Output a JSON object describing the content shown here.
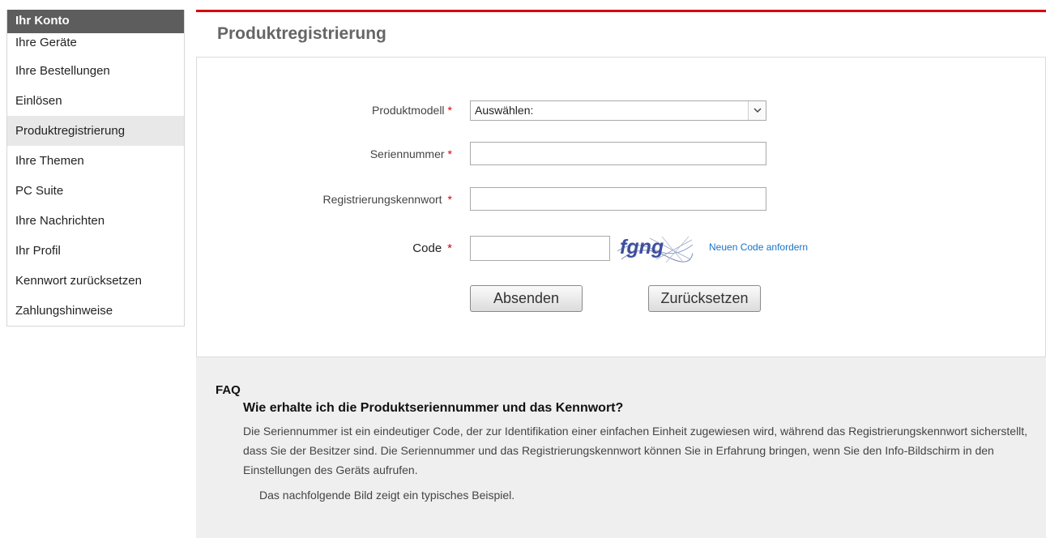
{
  "sidebar": {
    "title": "Ihr Konto",
    "items": [
      {
        "label": "Ihre Geräte"
      },
      {
        "label": "Ihre Bestellungen"
      },
      {
        "label": "Einlösen"
      },
      {
        "label": "Produktregistrierung"
      },
      {
        "label": "Ihre Themen"
      },
      {
        "label": "PC Suite"
      },
      {
        "label": "Ihre Nachrichten"
      },
      {
        "label": "Ihr Profil"
      },
      {
        "label": "Kennwort zurücksetzen"
      },
      {
        "label": "Zahlungshinweise"
      }
    ],
    "active_index": 3
  },
  "page": {
    "title": "Produktregistrierung",
    "accent_color": "#d7000f"
  },
  "form": {
    "required_marker": "*",
    "model": {
      "label": "Produktmodell",
      "selected": "Auswählen:"
    },
    "serial": {
      "label": "Seriennummer",
      "value": "",
      "placeholder": ""
    },
    "password": {
      "label": "Registrierungskennwort",
      "value": "",
      "placeholder": ""
    },
    "code": {
      "label": "Code",
      "value": "",
      "captcha_text": "fgng",
      "new_code_link": "Neuen Code anfordern"
    },
    "submit_label": "Absenden",
    "reset_label": "Zurücksetzen"
  },
  "faq": {
    "title": "FAQ",
    "question": "Wie erhalte ich die Produktseriennummer und das Kennwort?",
    "answer": "Die Seriennummer ist ein eindeutiger Code, der zur Identifikation einer einfachen Einheit zugewiesen wird, während das Registrierungskennwort sicherstellt, dass Sie der Besitzer sind. Die Seriennummer und das Registrierungskennwort können Sie in Erfahrung bringen, wenn Sie den Info-Bildschirm in den Einstellungen des Geräts aufrufen.",
    "note": "Das nachfolgende Bild zeigt ein typisches Beispiel."
  }
}
